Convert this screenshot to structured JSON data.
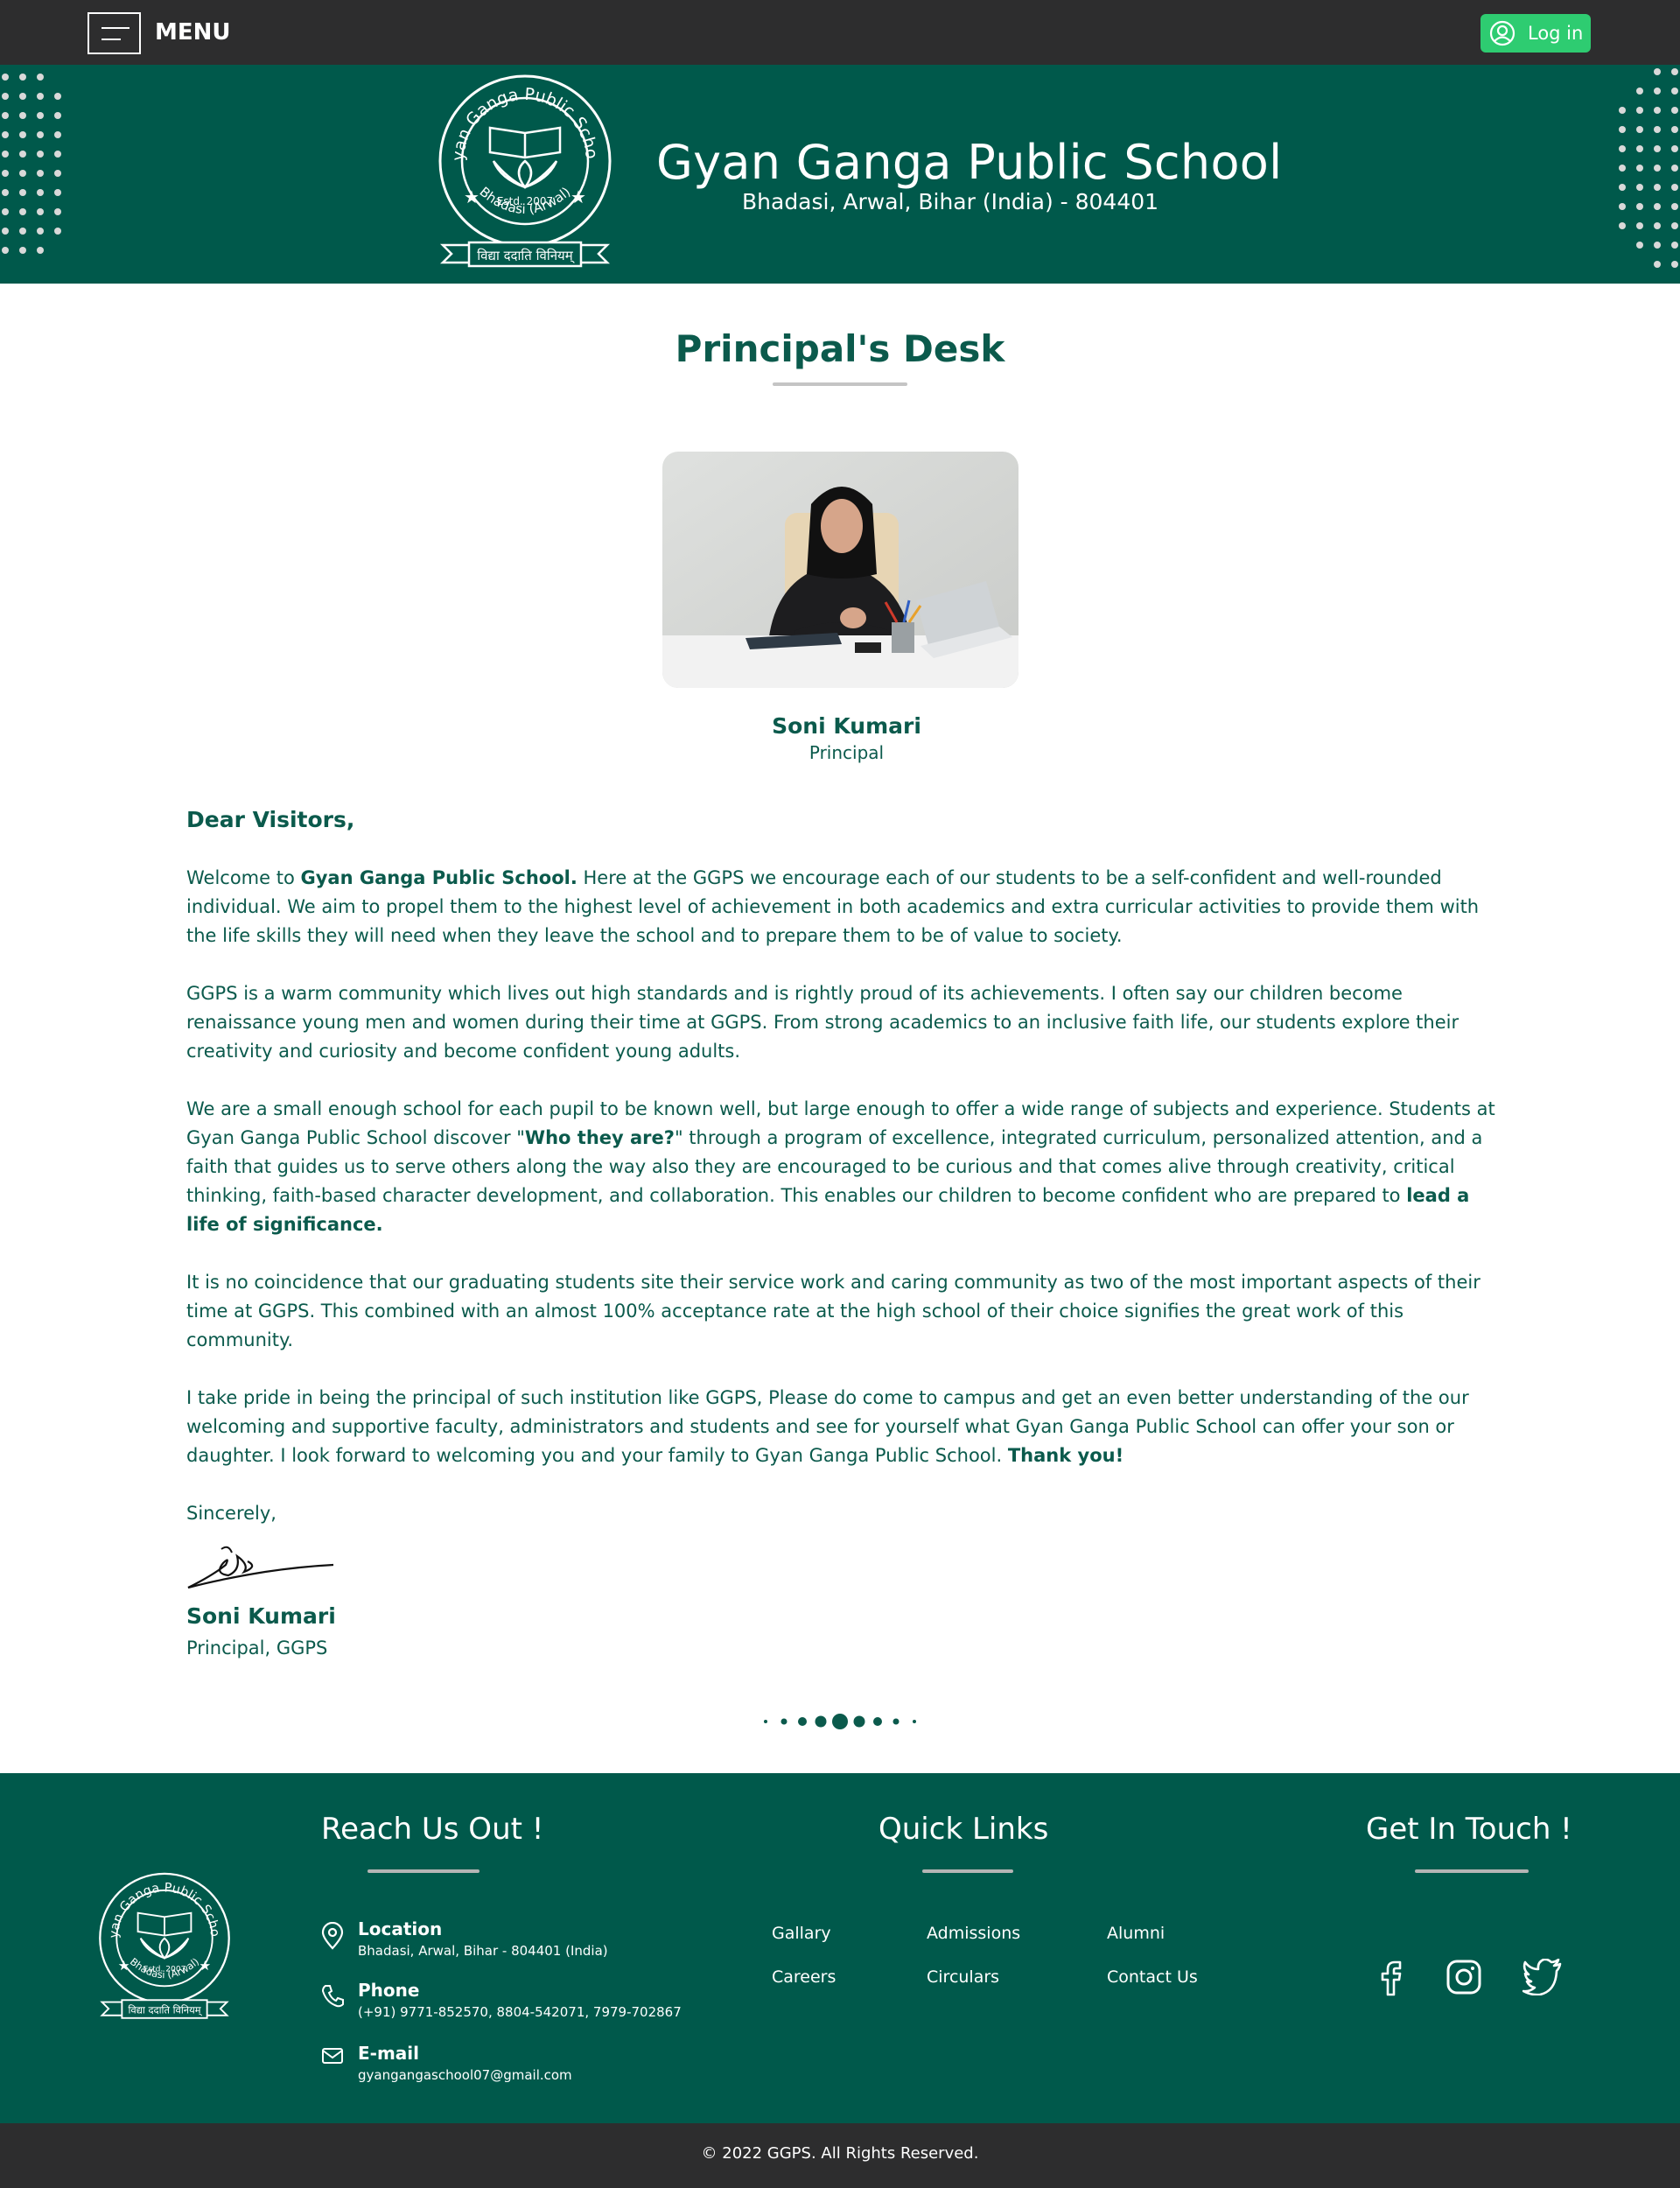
{
  "topbar": {
    "menu_label": "MENU",
    "login_label": "Log in"
  },
  "header": {
    "school_name": "Gyan Ganga Public School",
    "address": "Bhadasi, Arwal, Bihar (India) - 804401",
    "logo": {
      "arc_text": "Gyan Ganga Public School",
      "estd": "Estd. 2007",
      "location": "Bhadasi (Arwal)",
      "motto": "विद्या ददाति विनियम्"
    }
  },
  "main": {
    "title": "Principal's Desk",
    "principal_name": "Soni Kumari",
    "principal_role": "Principal",
    "greeting": "Dear Visitors,",
    "p1_a": "Welcome to ",
    "p1_b": "Gyan Ganga Public School.",
    "p1_c": " Here at the GGPS we encourage each of our students to be a self-confident and well-rounded individual. We aim to propel them to the highest level of achievement in both academics and extra curricular activities to provide them with the life skills they will need when they leave the school and to prepare them to be of value to society.",
    "p2": "GGPS is a warm community which lives out high standards and is rightly proud of its achievements. I often say our children become renaissance young men and women during their time at GGPS. From strong academics to an inclusive faith life, our students explore their creativity and curiosity and become confident young adults.",
    "p3_a": "We are a small enough school for each pupil to be known well, but large enough to offer a wide range of subjects and experience. Students at Gyan Ganga Public School discover \"",
    "p3_b": "Who they are?",
    "p3_c": "\" through a program of excellence, integrated curriculum, personalized attention, and a faith that guides us to serve others along the way also they are encouraged to be curious and that comes alive through creativity, critical thinking, faith-based character development, and collaboration. This enables our children to become confident who are prepared to ",
    "p3_d": "lead a life of significance.",
    "p4": "It is no coincidence that our graduating students site their service work and caring community as two of the most important aspects of their time at GGPS. This combined with an almost 100% acceptance rate at the high school of their choice signifies the great work of this community.",
    "p5_a": "I take pride in being the principal of such institution like GGPS, Please do come to campus and get an even better understanding of the our welcoming and supportive faculty, administrators and students and see for yourself what Gyan Ganga Public School can offer your son or daughter. I look forward to welcoming you and your family to Gyan Ganga Public School. ",
    "p5_b": "Thank you!",
    "closing": "Sincerely,",
    "sign_name": "Soni Kumari",
    "sign_role": "Principal, GGPS"
  },
  "footer": {
    "reach_title": "Reach Us Out !",
    "quick_title": "Quick Links",
    "touch_title": "Get In Touch !",
    "contacts": [
      {
        "title": "Location",
        "text": "Bhadasi, Arwal, Bihar - 804401 (India)",
        "icon": "location-pin-icon"
      },
      {
        "title": "Phone",
        "text": "(+91) 9771-852570, 8804-542071, 7979-702867",
        "icon": "phone-icon"
      },
      {
        "title": "E-mail",
        "text": "gyangangaschool07@gmail.com",
        "icon": "mail-icon"
      }
    ],
    "links": [
      "Gallary",
      "Admissions",
      "Alumni",
      "Careers",
      "Circulars",
      "Contact Us"
    ],
    "social": [
      "facebook-icon",
      "instagram-icon",
      "twitter-icon"
    ],
    "copyright": "© 2022 GGPS. All Rights Reserved."
  },
  "colors": {
    "brand_green": "#00594b",
    "text_green": "#0b5a4c",
    "dark_bar": "#2d2d2e",
    "login_green": "#2ecc71"
  }
}
